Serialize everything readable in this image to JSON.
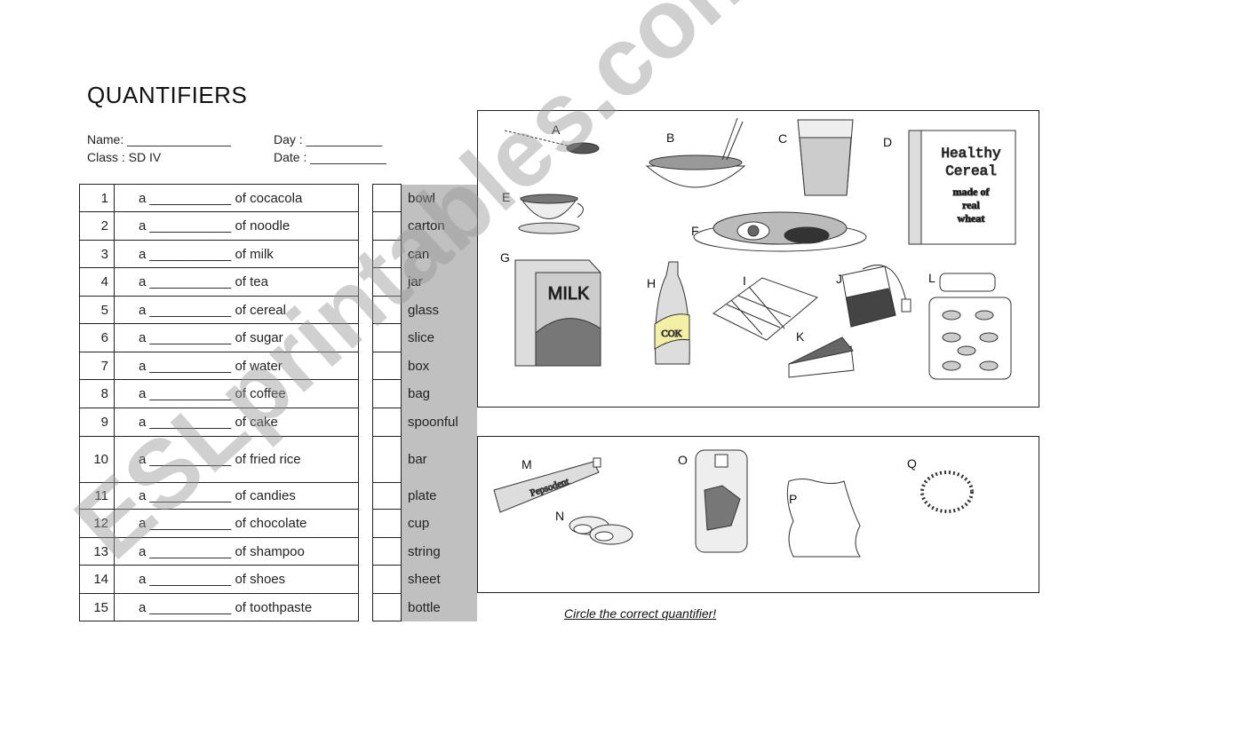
{
  "title": "QUANTIFIERS",
  "header": {
    "name_label": "Name: _______________",
    "day_label": "Day  : ___________",
    "class_label": "Class : SD IV",
    "date_label": "Date : ___________"
  },
  "rows": [
    {
      "num": "1",
      "text": "a ___________ of cocacola"
    },
    {
      "num": "2",
      "text": "a ___________ of noodle"
    },
    {
      "num": "3",
      "text": "a ___________ of milk"
    },
    {
      "num": "4",
      "text": "a ___________ of tea"
    },
    {
      "num": "5",
      "text": "a ___________ of cereal"
    },
    {
      "num": "6",
      "text": "a ___________ of sugar"
    },
    {
      "num": "7",
      "text": "a ___________ of water"
    },
    {
      "num": "8",
      "text": "a ___________ of coffee"
    },
    {
      "num": "9",
      "text": "a ___________ of cake"
    },
    {
      "num": "10",
      "text": "a ___________ of fried rice"
    },
    {
      "num": "11",
      "text": "a ___________ of candies"
    },
    {
      "num": "12",
      "text": "a ___________ of chocolate"
    },
    {
      "num": "13",
      "text": "a ___________ of shampoo"
    },
    {
      "num": "14",
      "text": "a ___________ of shoes"
    },
    {
      "num": "15",
      "text": "a ___________ of toothpaste"
    }
  ],
  "words": [
    "bowl",
    "carton",
    "can",
    "jar",
    "glass",
    "slice",
    "box",
    "bag",
    "spoonful",
    "bar",
    "plate",
    "cup",
    "string",
    "sheet",
    "bottle"
  ],
  "pictures": {
    "labels": [
      "A",
      "B",
      "C",
      "D",
      "E",
      "F",
      "G",
      "H",
      "I",
      "J",
      "K",
      "L",
      "M",
      "N",
      "O",
      "P",
      "Q"
    ],
    "cereal_box_text": [
      "Healthy",
      "Cereal",
      "made of",
      "real",
      "wheat"
    ],
    "milk_text": "MILK",
    "cok_text": "COK",
    "toothpaste_text": "Pepsodent"
  },
  "instruction": "Circle the correct quantifier!",
  "watermark": "ESLprintables.com"
}
